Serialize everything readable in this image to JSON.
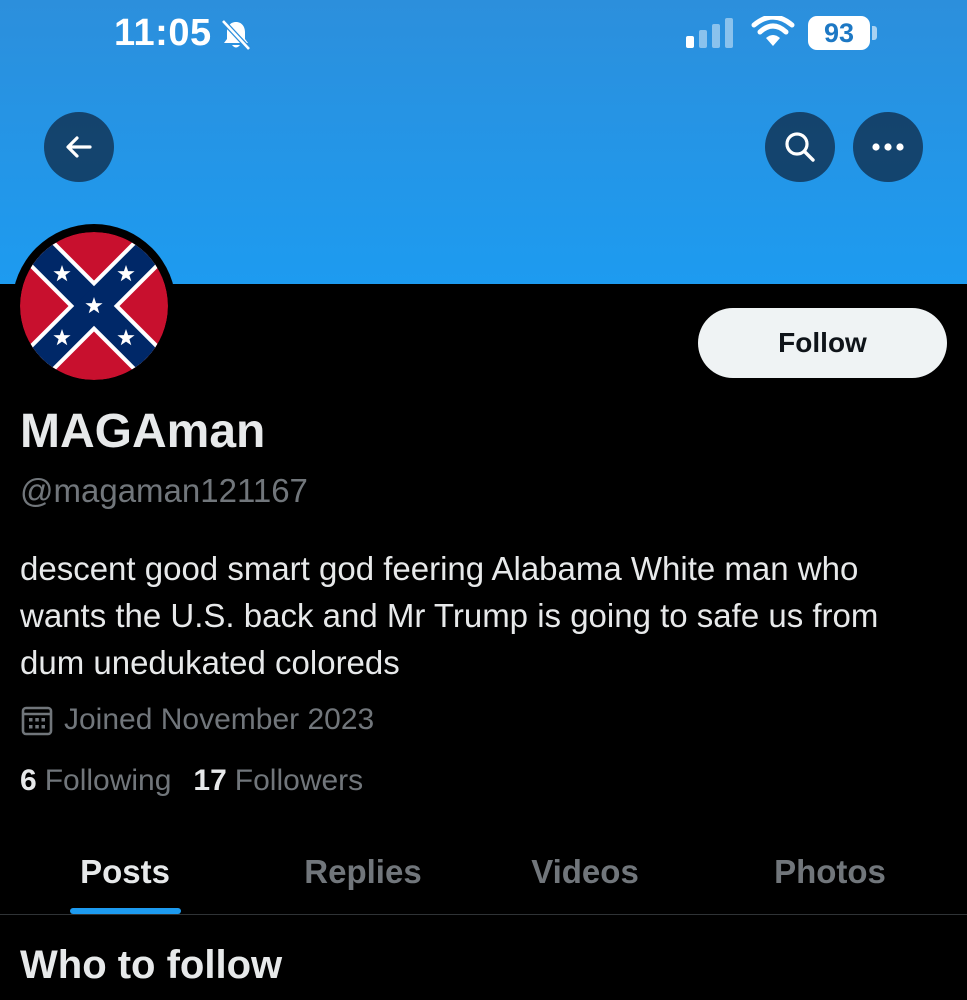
{
  "status_bar": {
    "time": "11:05",
    "battery": "93",
    "icons": [
      "bell-muted-icon",
      "cellular-signal-icon",
      "wifi-icon",
      "battery-icon"
    ]
  },
  "header": {
    "back_icon": "arrow-left-icon",
    "search_icon": "search-icon",
    "more_icon": "more-horizontal-icon"
  },
  "colors": {
    "banner": "#1d9bf0",
    "accent": "#1d9bf0",
    "muted_text": "#71767b",
    "follow_button_bg": "#eff3f4"
  },
  "profile": {
    "follow_label": "Follow",
    "display_name": "MAGAman",
    "handle": "@magaman121167",
    "bio": "descent good smart god feering Alabama White man who wants the U.S. back and Mr Trump is going to safe us from dum unedukated coloreds",
    "joined": "Joined November 2023",
    "following_count": "6",
    "following_label": "Following",
    "followers_count": "17",
    "followers_label": "Followers"
  },
  "tabs": [
    {
      "label": "Posts",
      "active": true
    },
    {
      "label": "Replies",
      "active": false
    },
    {
      "label": "Videos",
      "active": false
    },
    {
      "label": "Photos",
      "active": false
    }
  ],
  "section": {
    "title": "Who to follow"
  }
}
